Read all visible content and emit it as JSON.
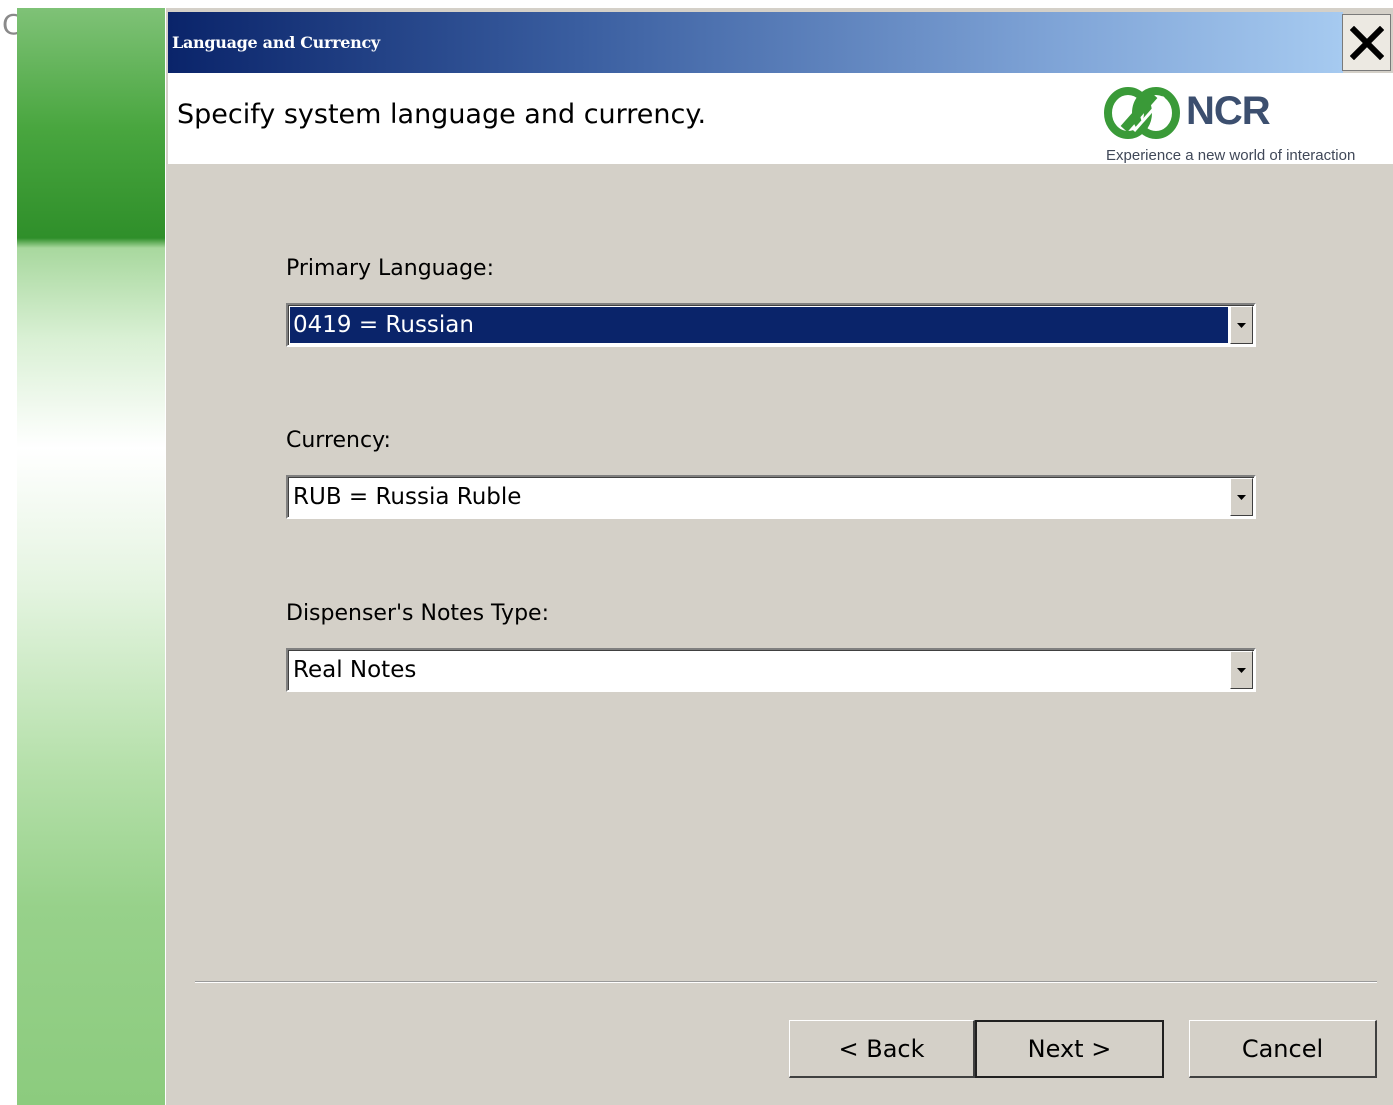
{
  "corner_glyph": "C",
  "window": {
    "title": "Language and Currency"
  },
  "header": {
    "instruction": "Specify system language and currency.",
    "logo": {
      "wordmark": "NCR",
      "tagline": "Experience a new world of interaction",
      "brand_color": "#3a9a38"
    }
  },
  "fields": [
    {
      "label": "Primary Language:",
      "value": "0419 = Russian",
      "selected": true
    },
    {
      "label": "Currency:",
      "value": "RUB = Russia Ruble",
      "selected": false
    },
    {
      "label": "Dispenser's Notes Type:",
      "value": "Real Notes",
      "selected": false
    }
  ],
  "buttons": {
    "back": "< Back",
    "next": "Next >",
    "cancel": "Cancel"
  },
  "colors": {
    "selection": "#0a246a",
    "dialog_bg": "#d4d0c8"
  }
}
